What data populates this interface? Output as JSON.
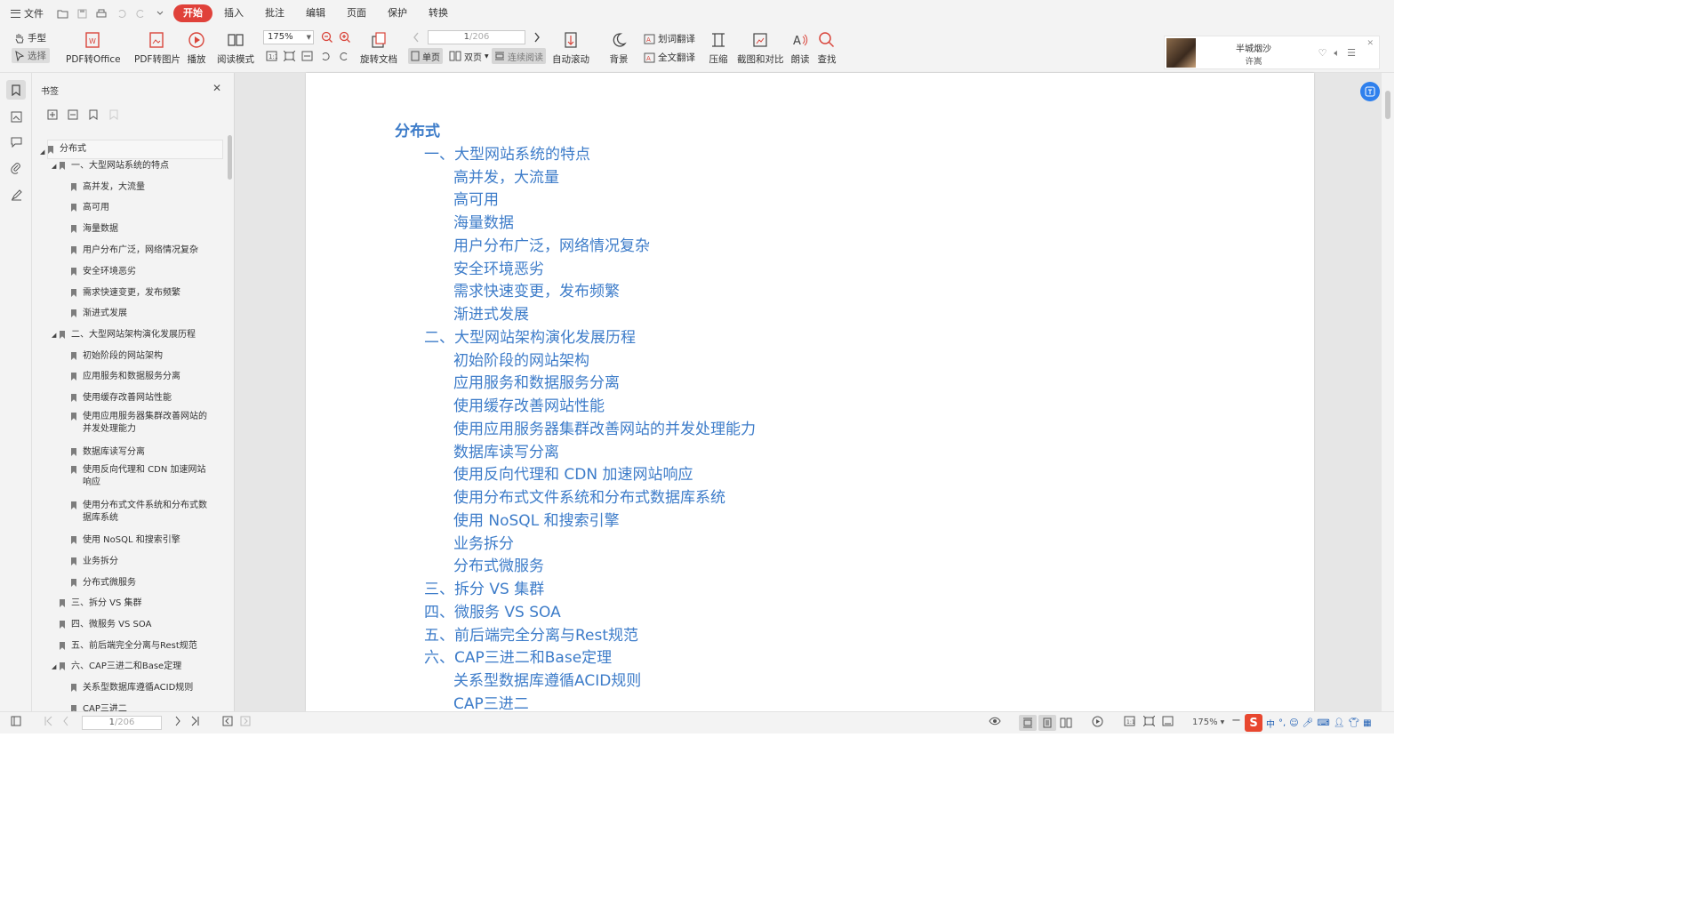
{
  "menubar": {
    "file_label": "文件",
    "tabs": [
      "开始",
      "插入",
      "批注",
      "编辑",
      "页面",
      "保护",
      "转换"
    ],
    "active_tab": "开始"
  },
  "ribbon": {
    "hand_label": "手型",
    "select_label": "选择",
    "pdf_to_office_label": "PDF转Office",
    "pdf_to_image_label": "PDF转图片",
    "play_label": "播放",
    "reading_mode_label": "阅读模式",
    "zoom_value": "175%",
    "rotate_label": "旋转文档",
    "page_current": "1",
    "page_total": "/206",
    "single_page_label": "单页",
    "double_page_label": "双页",
    "continuous_label": "连续阅读",
    "auto_scroll_label": "自动滚动",
    "background_label": "背景",
    "word_translate_label": "划词翻译",
    "full_translate_label": "全文翻译",
    "compress_label": "压缩",
    "screenshot_compare_label": "截图和对比",
    "read_aloud_label": "朗读",
    "find_label": "查找"
  },
  "music": {
    "title": "半城烟沙",
    "artist": "许嵩"
  },
  "bookmarks": {
    "header": "书签",
    "items": [
      {
        "label": "分布式"
      },
      {
        "label": "一、大型网站系统的特点"
      },
      {
        "label": "高并发，大流量"
      },
      {
        "label": "高可用"
      },
      {
        "label": "海量数据"
      },
      {
        "label": "用户分布广泛，网络情况复杂"
      },
      {
        "label": "安全环境恶劣"
      },
      {
        "label": "需求快速变更，发布频繁"
      },
      {
        "label": "渐进式发展"
      },
      {
        "label": "二、大型网站架构演化发展历程"
      },
      {
        "label": "初始阶段的网站架构"
      },
      {
        "label": "应用服务和数据服务分离"
      },
      {
        "label": "使用缓存改善网站性能"
      },
      {
        "label": "使用应用服务器集群改善网站的并发处理能力"
      },
      {
        "label": "数据库读写分离"
      },
      {
        "label": "使用反向代理和 CDN 加速网站响应"
      },
      {
        "label": "使用分布式文件系统和分布式数据库系统"
      },
      {
        "label": "使用 NoSQL 和搜索引擎"
      },
      {
        "label": "业务拆分"
      },
      {
        "label": "分布式微服务"
      },
      {
        "label": "三、拆分 VS 集群"
      },
      {
        "label": "四、微服务 VS SOA"
      },
      {
        "label": "五、前后端完全分离与Rest规范"
      },
      {
        "label": "六、CAP三进二和Base定理"
      },
      {
        "label": "关系型数据库遵循ACID规则"
      },
      {
        "label": "CAP三进二"
      }
    ]
  },
  "document": {
    "toc": [
      {
        "text": "分布式"
      },
      {
        "text": "一、大型网站系统的特点"
      },
      {
        "text": "高并发，大流量"
      },
      {
        "text": "高可用"
      },
      {
        "text": "海量数据"
      },
      {
        "text": "用户分布广泛，网络情况复杂"
      },
      {
        "text": "安全环境恶劣"
      },
      {
        "text": "需求快速变更，发布频繁"
      },
      {
        "text": "渐进式发展"
      },
      {
        "text": "二、大型网站架构演化发展历程"
      },
      {
        "text": "初始阶段的网站架构"
      },
      {
        "text": "应用服务和数据服务分离"
      },
      {
        "text": "使用缓存改善网站性能"
      },
      {
        "text": "使用应用服务器集群改善网站的并发处理能力"
      },
      {
        "text": "数据库读写分离"
      },
      {
        "text": "使用反向代理和 CDN 加速网站响应"
      },
      {
        "text": "使用分布式文件系统和分布式数据库系统"
      },
      {
        "text": "使用 NoSQL 和搜索引擎"
      },
      {
        "text": "业务拆分"
      },
      {
        "text": "分布式微服务"
      },
      {
        "text": "三、拆分 VS 集群"
      },
      {
        "text": "四、微服务 VS SOA"
      },
      {
        "text": "五、前后端完全分离与Rest规范"
      },
      {
        "text": "六、CAP三进二和Base定理"
      },
      {
        "text": "关系型数据库遵循ACID规则"
      },
      {
        "text": "CAP三进二"
      }
    ]
  },
  "statusbar": {
    "page_current": "1",
    "page_total": "/206",
    "zoom_value": "175%",
    "ime_label": "中"
  },
  "colors": {
    "accent": "#e0413a",
    "link_blue": "#3d7cc9"
  }
}
